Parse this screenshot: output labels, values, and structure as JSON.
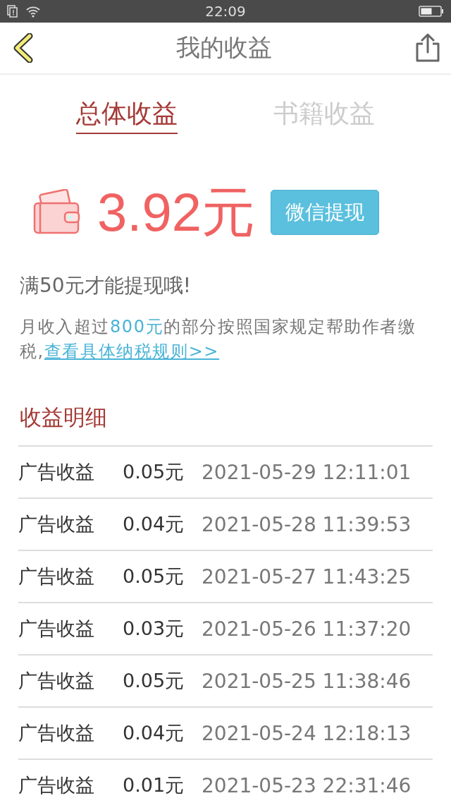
{
  "status_bar": {
    "time": "22:09"
  },
  "header": {
    "title": "我的收益"
  },
  "tabs": [
    {
      "label": "总体收益",
      "selected": true
    },
    {
      "label": "书籍收益",
      "selected": false
    }
  ],
  "balance": {
    "amount": "3.92元",
    "withdraw_button": "微信提现"
  },
  "minimum_note": "满50元才能提现哦!",
  "tax_note": {
    "before": "月收入超过",
    "highlight": "800元",
    "after": "的部分按照国家规定帮助作者缴税,",
    "link": "查看具体纳税规则>>"
  },
  "details": {
    "title": "收益明细",
    "rows": [
      {
        "type": "广告收益",
        "amount": "0.05元",
        "time": "2021-05-29 12:11:01"
      },
      {
        "type": "广告收益",
        "amount": "0.04元",
        "time": "2021-05-28 11:39:53"
      },
      {
        "type": "广告收益",
        "amount": "0.05元",
        "time": "2021-05-27 11:43:25"
      },
      {
        "type": "广告收益",
        "amount": "0.03元",
        "time": "2021-05-26 11:37:20"
      },
      {
        "type": "广告收益",
        "amount": "0.05元",
        "time": "2021-05-25 11:38:46"
      },
      {
        "type": "广告收益",
        "amount": "0.04元",
        "time": "2021-05-24 12:18:13"
      },
      {
        "type": "广告收益",
        "amount": "0.01元",
        "time": "2021-05-23 22:31:46"
      }
    ]
  }
}
